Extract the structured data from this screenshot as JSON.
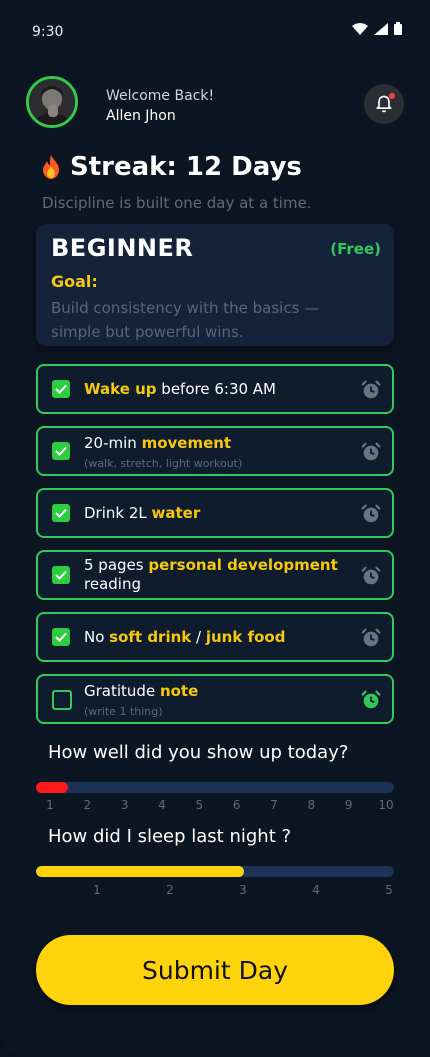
{
  "status": {
    "time": "9:30"
  },
  "header": {
    "welcome": "Welcome Back!",
    "username": "Allen Jhon"
  },
  "streak": {
    "title": "Streak: 12 Days",
    "tagline": "Discipline is built one day at a time."
  },
  "level": {
    "name": "BEGINNER",
    "tag": "(Free)",
    "goal_label": "Goal:",
    "goal_text": "Build consistency with the basics — simple but powerful wins."
  },
  "tasks": [
    {
      "checked": true,
      "prefix": "",
      "highlight": "Wake up",
      "suffix": " before 6:30 AM",
      "sub": ""
    },
    {
      "checked": true,
      "prefix": "20-min ",
      "highlight": "movement",
      "suffix": "",
      "sub": "(walk, stretch, light workout)"
    },
    {
      "checked": true,
      "prefix": "Drink 2L ",
      "highlight": "water",
      "suffix": "",
      "sub": ""
    },
    {
      "checked": true,
      "prefix": "5 pages ",
      "highlight": "personal development",
      "suffix": "",
      "line2": "reading",
      "sub": ""
    },
    {
      "checked": true,
      "prefix": "No ",
      "highlight": "soft drink",
      "mid": " / ",
      "highlight2": "junk food",
      "suffix": "",
      "sub": ""
    },
    {
      "checked": false,
      "prefix": "Gratitude ",
      "highlight": "note",
      "suffix": "",
      "sub": "(write 1 thing)"
    }
  ],
  "rating": {
    "question": "How well did you show up today?",
    "value": 1.5,
    "max": 10,
    "ticks": [
      "1",
      "2",
      "3",
      "4",
      "5",
      "6",
      "7",
      "8",
      "9",
      "10"
    ],
    "color": "#ff1a1a"
  },
  "sleep": {
    "question": "How did I sleep last night ?",
    "value": 0.58,
    "ticks": [
      "1",
      "2",
      "3",
      "4",
      "5"
    ],
    "color": "#fdd40b"
  },
  "submit_label": "Submit Day",
  "colors": {
    "accent_green": "#34c759",
    "accent_yellow": "#f6c90e",
    "background": "#0c1522"
  }
}
